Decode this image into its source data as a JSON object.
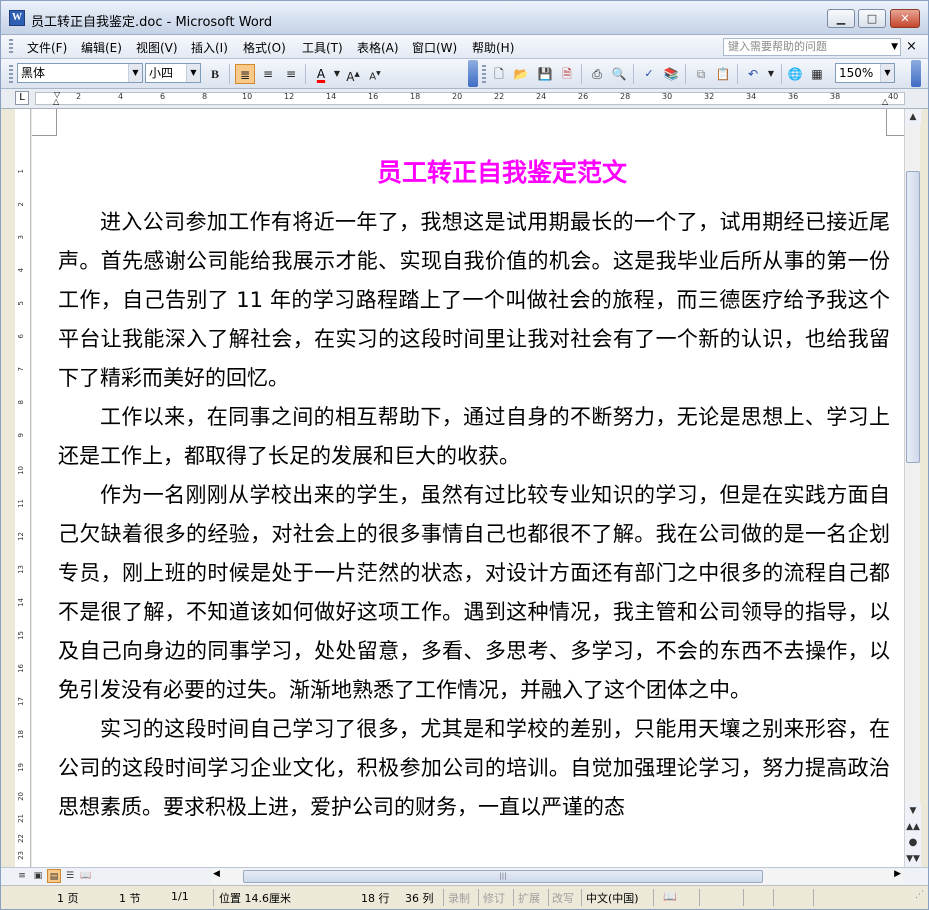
{
  "window": {
    "title": "员工转正自我鉴定.doc - Microsoft Word",
    "app_icon": "word-doc-icon",
    "controls": {
      "minimize": "▁",
      "maximize": "□",
      "close": "✕"
    }
  },
  "menubar": {
    "items": [
      "文件(F)",
      "编辑(E)",
      "视图(V)",
      "插入(I)",
      "格式(O)",
      "工具(T)",
      "表格(A)",
      "窗口(W)",
      "帮助(H)"
    ],
    "help_placeholder": "键入需要帮助的问题",
    "close_glyph": "×"
  },
  "toolbar": {
    "font": "黑体",
    "size": "小四",
    "bold": "B",
    "zoom": "150%",
    "font_color": "#ff0000",
    "active_align": "align-justify"
  },
  "ruler": {
    "numbers": [
      "2",
      "4",
      "6",
      "8",
      "10",
      "12",
      "14",
      "16",
      "18",
      "20",
      "22",
      "24",
      "26",
      "28",
      "30",
      "32",
      "34",
      "36",
      "38",
      "40"
    ],
    "tab_selector": "L"
  },
  "vruler": {
    "numbers": [
      "1",
      "2",
      "3",
      "4",
      "5",
      "6",
      "7",
      "8",
      "9",
      "10",
      "11",
      "12",
      "13",
      "14",
      "15",
      "16",
      "17",
      "18",
      "19",
      "20",
      "21",
      "22",
      "23"
    ]
  },
  "document": {
    "title": "员工转正自我鉴定范文",
    "title_color": "#ff00ff",
    "paragraphs": [
      "进入公司参加工作有将近一年了，我想这是试用期最长的一个了，试用期经已接近尾声。首先感谢公司能给我展示才能、实现自我价值的机会。这是我毕业后所从事的第一份工作，自己告别了 11 年的学习路程踏上了一个叫做社会的旅程，而三德医疗给予我这个平台让我能深入了解社会，在实习的这段时间里让我对社会有了一个新的认识，也给我留下了精彩而美好的回忆。",
      "工作以来，在同事之间的相互帮助下，通过自身的不断努力，无论是思想上、学习上还是工作上，都取得了长足的发展和巨大的收获。",
      "作为一名刚刚从学校出来的学生，虽然有过比较专业知识的学习，但是在实践方面自己欠缺着很多的经验，对社会上的很多事情自己也都很不了解。我在公司做的是一名企划专员，刚上班的时候是处于一片茫然的状态，对设计方面还有部门之中很多的流程自己都不是很了解，不知道该如何做好这项工作。遇到这种情况，我主管和公司领导的指导，以及自己向身边的同事学习，处处留意，多看、多思考、多学习，不会的东西不去操作，以免引发没有必要的过失。渐渐地熟悉了工作情况，并融入了这个团体之中。",
      "实习的这段时间自己学习了很多，尤其是和学校的差别，只能用天壤之别来形容，在公司的这段时间学习企业文化，积极参加公司的培训。自觉加强理论学习，努力提高政治思想素质。要求积极上进，爱护公司的财务，一直以严谨的态"
    ]
  },
  "status": {
    "page": "1 页",
    "section": "1 节",
    "pages": "1/1",
    "position": "位置 14.6厘米",
    "line": "18 行",
    "col": "36 列",
    "rec": "录制",
    "trk": "修订",
    "ext": "扩展",
    "ovr": "改写",
    "lang": "中文(中国)"
  }
}
